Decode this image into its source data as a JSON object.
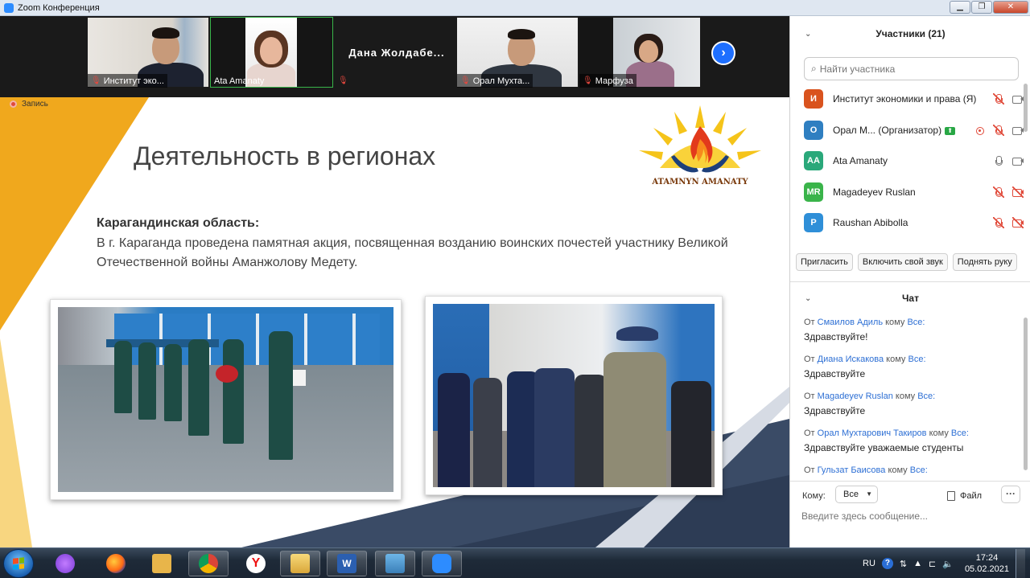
{
  "window": {
    "title": "Zoom Конференция"
  },
  "video_strip": {
    "tiles": [
      {
        "name": "Институт эко...",
        "muted": true
      },
      {
        "name": "Ata Amanaty",
        "muted": false,
        "active": true
      },
      {
        "name": "Дана  Жолдабе...",
        "muted": true,
        "text_only": true
      },
      {
        "name": "Орал Мухта...",
        "muted": true
      },
      {
        "name": "Марфуза",
        "muted": true
      }
    ],
    "next_icon": "›"
  },
  "recording": {
    "label": "Запись"
  },
  "slide": {
    "title": "Деятельность в регионах",
    "logo_text": "ATAMNYN AMANATY",
    "region_heading": "Карагандинская область:",
    "region_text": "В г. Караганда проведена памятная акция, посвященная возданию воинских почестей участнику Великой Отечественной войны Аманжолову Медету."
  },
  "participants": {
    "title": "Участники (21)",
    "search_placeholder": "Найти участника",
    "items": [
      {
        "initial": "И",
        "name": "Институт экономики и права (Я)",
        "color": "#d9531e",
        "mic": "muted",
        "cam": "on"
      },
      {
        "initial": "О",
        "name": "Орал М... (Организатор)",
        "color": "#2f7fc1",
        "mic": "recording",
        "cam": "on",
        "sharing": true
      },
      {
        "initial": "AA",
        "name": "Ata Amanaty",
        "color": "#2aa87a",
        "mic": "on",
        "cam": "on"
      },
      {
        "initial": "MR",
        "name": "Magadeyev Ruslan",
        "color": "#3ab44a",
        "mic": "muted",
        "cam": "off"
      },
      {
        "initial": "P",
        "name": "Raushan Abibolla",
        "color": "#2f8fd8",
        "mic": "muted",
        "cam": "off"
      }
    ],
    "buttons": {
      "invite": "Пригласить",
      "unmute": "Включить свой звук",
      "raise_hand": "Поднять руку"
    }
  },
  "chat": {
    "title": "Чат",
    "messages": [
      {
        "from_prefix": "От",
        "from": "Смаилов Адиль",
        "to_prefix": "кому",
        "to": "Все:",
        "text": "Здравствуйте!"
      },
      {
        "from_prefix": "От",
        "from": "Диана Искакова",
        "to_prefix": "кому",
        "to": "Все:",
        "text": "Здравствуйте"
      },
      {
        "from_prefix": "От",
        "from": "Magadeyev Ruslan",
        "to_prefix": "кому",
        "to": "Все:",
        "text": "Здравствуйте"
      },
      {
        "from_prefix": "От",
        "from": "Орал Мухтарович Такиров",
        "to_prefix": "кому",
        "to": "Все:",
        "text": "Здравствуйте уважаемые студенты"
      },
      {
        "from_prefix": "От",
        "from": "Гульзат Баисова",
        "to_prefix": "кому",
        "to": "Все:",
        "text": ""
      }
    ],
    "to_label": "Кому:",
    "to_value": "Все",
    "file_label": "Файл",
    "more_label": "···",
    "input_placeholder": "Введите здесь сообщение..."
  },
  "taskbar": {
    "lang": "RU",
    "help": "?",
    "time": "17:24",
    "date": "05.02.2021"
  }
}
